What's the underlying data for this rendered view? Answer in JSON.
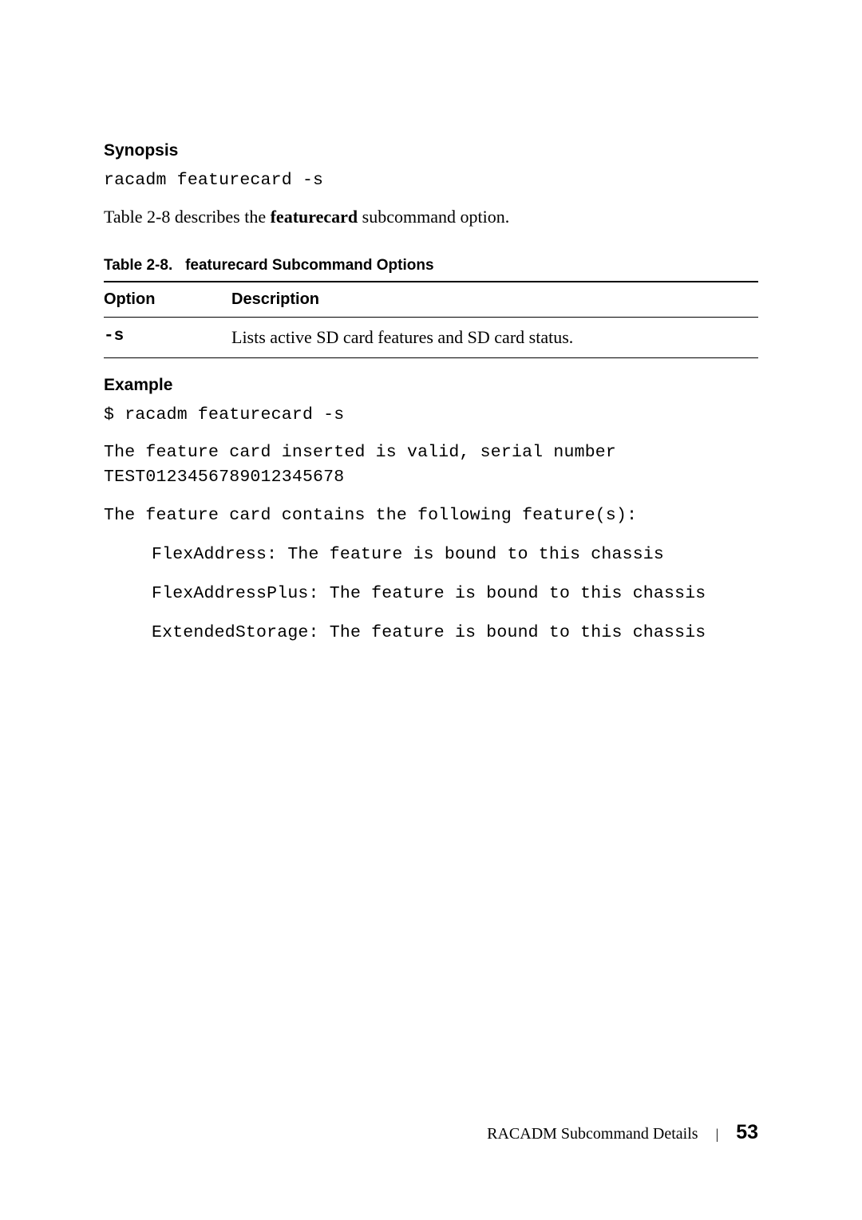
{
  "synopsis": {
    "heading": "Synopsis",
    "command": "racadm featurecard -s",
    "intro_pre": "Table 2-8 describes the ",
    "intro_bold": "featurecard",
    "intro_post": " subcommand option."
  },
  "table": {
    "caption_label": "Table 2-8.",
    "caption_title": "featurecard Subcommand Options",
    "headers": {
      "option": "Option",
      "description": "Description"
    },
    "rows": [
      {
        "option": "-s",
        "description": "Lists active SD card features and SD card status."
      }
    ]
  },
  "example": {
    "heading": "Example",
    "cmd": "$ racadm featurecard -s",
    "line1": "The feature card inserted is valid, serial number TEST0123456789012345678",
    "line2": "The feature card contains the following feature(s):",
    "features": [
      "FlexAddress: The feature is bound to this chassis",
      "FlexAddressPlus: The feature is bound to this chassis",
      "ExtendedStorage: The feature is bound to this chassis"
    ]
  },
  "footer": {
    "title": "RACADM Subcommand Details",
    "sep": "|",
    "page": "53"
  }
}
